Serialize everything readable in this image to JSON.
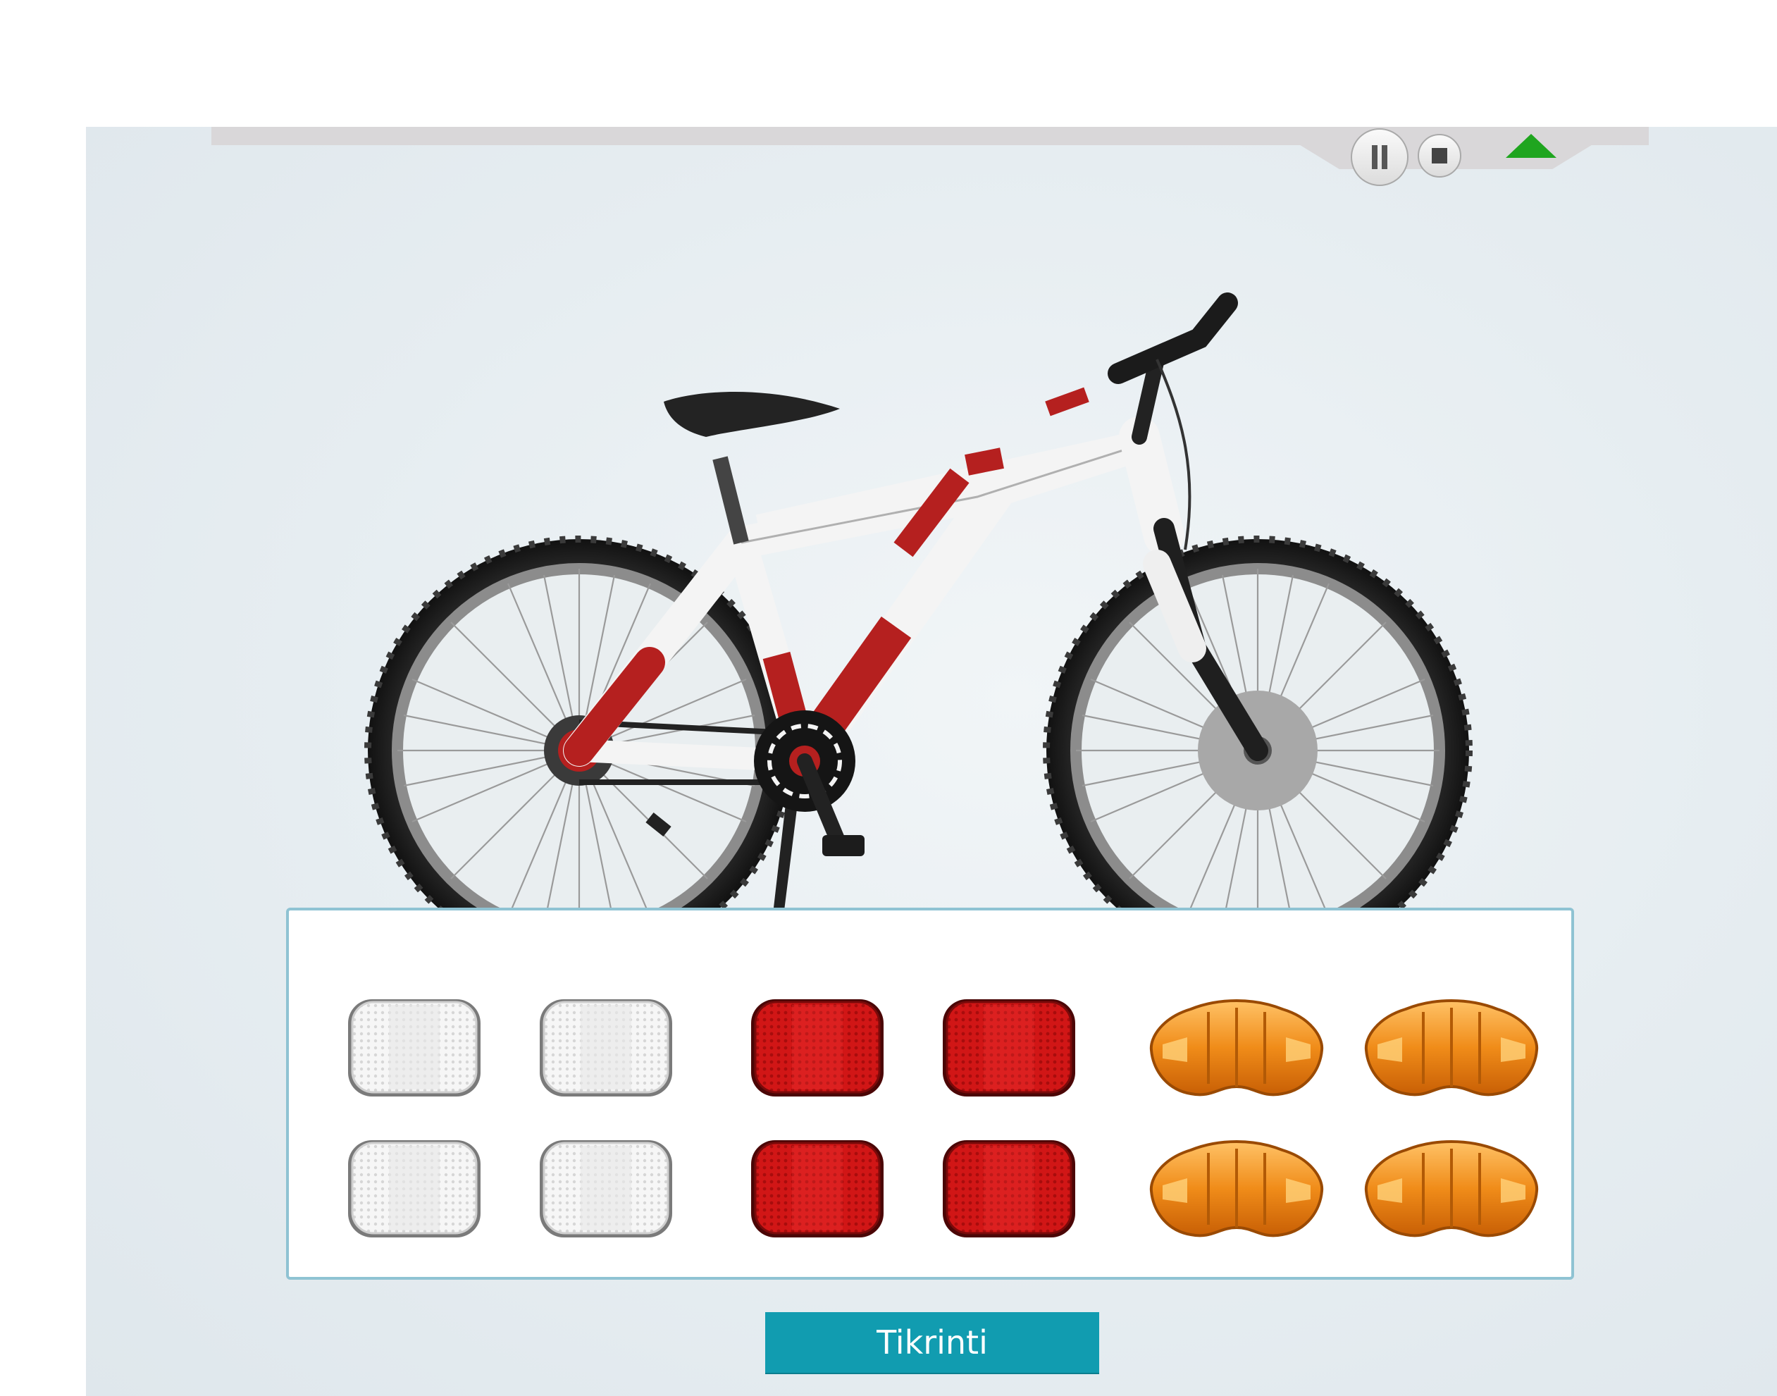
{
  "player": {
    "pause_icon": "pause-icon",
    "stop_icon": "stop-icon",
    "collapse_icon": "triangle-up-icon",
    "collapse_color": "#1fa51f"
  },
  "scene": {
    "subject": "bicycle",
    "frame_color": "#ffffff",
    "stripe_color": "#b5201f"
  },
  "tray": {
    "border_color": "#8fc3d3",
    "reflectors": [
      {
        "color": "white"
      },
      {
        "color": "white"
      },
      {
        "color": "red"
      },
      {
        "color": "red"
      },
      {
        "color": "orange"
      },
      {
        "color": "orange"
      },
      {
        "color": "white"
      },
      {
        "color": "white"
      },
      {
        "color": "red"
      },
      {
        "color": "red"
      },
      {
        "color": "orange"
      },
      {
        "color": "orange"
      }
    ]
  },
  "actions": {
    "check_label": "Tikrinti",
    "check_color": "#119cb0"
  }
}
